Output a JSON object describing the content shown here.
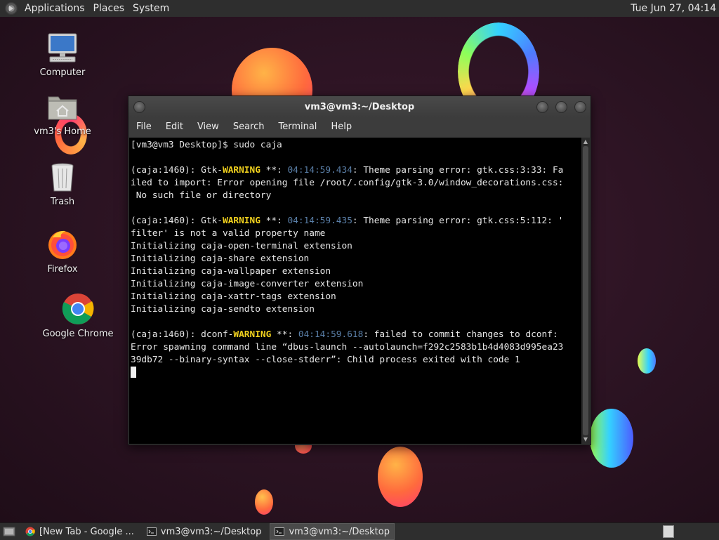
{
  "top_panel": {
    "menus": [
      "Applications",
      "Places",
      "System"
    ],
    "clock": "Tue Jun 27, 04:14"
  },
  "desktop_icons": [
    {
      "label": "Computer",
      "icon": "computer-icon"
    },
    {
      "label": "vm3's Home",
      "icon": "home-folder-icon"
    },
    {
      "label": "Trash",
      "icon": "trash-icon"
    },
    {
      "label": "Firefox",
      "icon": "firefox-icon"
    },
    {
      "label": "Google Chrome",
      "icon": "chrome-icon"
    }
  ],
  "terminal": {
    "title": "vm3@vm3:~/Desktop",
    "menus": [
      "File",
      "Edit",
      "View",
      "Search",
      "Terminal",
      "Help"
    ],
    "lines": [
      {
        "text": "[vm3@vm3 Desktop]$ sudo caja"
      },
      {
        "text": ""
      },
      {
        "parts": [
          {
            "t": "(caja:1460): Gtk-"
          },
          {
            "t": "WARNING",
            "c": "warn"
          },
          {
            "t": " **: "
          },
          {
            "t": "04:14:59.434",
            "c": "ts"
          },
          {
            "t": ": Theme parsing error: gtk.css:3:33: Fa"
          }
        ]
      },
      {
        "text": "iled to import: Error opening file /root/.config/gtk-3.0/window_decorations.css:"
      },
      {
        "text": " No such file or directory"
      },
      {
        "text": ""
      },
      {
        "parts": [
          {
            "t": "(caja:1460): Gtk-"
          },
          {
            "t": "WARNING",
            "c": "warn"
          },
          {
            "t": " **: "
          },
          {
            "t": "04:14:59.435",
            "c": "ts"
          },
          {
            "t": ": Theme parsing error: gtk.css:5:112: '"
          }
        ]
      },
      {
        "text": "filter' is not a valid property name"
      },
      {
        "text": "Initializing caja-open-terminal extension"
      },
      {
        "text": "Initializing caja-share extension"
      },
      {
        "text": "Initializing caja-wallpaper extension"
      },
      {
        "text": "Initializing caja-image-converter extension"
      },
      {
        "text": "Initializing caja-xattr-tags extension"
      },
      {
        "text": "Initializing caja-sendto extension"
      },
      {
        "text": ""
      },
      {
        "parts": [
          {
            "t": "(caja:1460): dconf-"
          },
          {
            "t": "WARNING",
            "c": "warn"
          },
          {
            "t": " **: "
          },
          {
            "t": "04:14:59.618",
            "c": "ts"
          },
          {
            "t": ": failed to commit changes to dconf:"
          }
        ]
      },
      {
        "text": "Error spawning command line “dbus-launch --autolaunch=f292c2583b1b4d4083d995ea23"
      },
      {
        "text": "39db72 --binary-syntax --close-stderr”: Child process exited with code 1"
      }
    ]
  },
  "taskbar": {
    "tasks": [
      {
        "label": "[New Tab - Google ...",
        "icon": "chrome-icon",
        "active": false
      },
      {
        "label": "vm3@vm3:~/Desktop",
        "icon": "terminal-icon",
        "active": false
      },
      {
        "label": "vm3@vm3:~/Desktop",
        "icon": "terminal-icon",
        "active": true
      }
    ]
  },
  "colors": {
    "warning": "#f2d21e",
    "timestamp": "#5a7fa8",
    "terminal_bg": "#000000",
    "panel_bg": "#2e2e2e"
  }
}
